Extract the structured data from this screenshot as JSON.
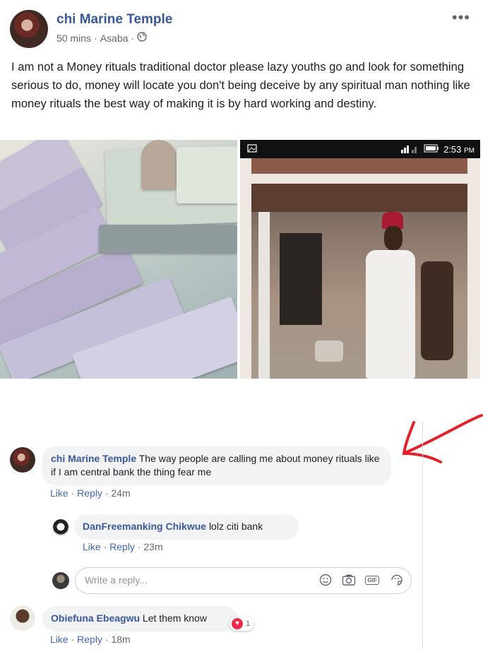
{
  "post": {
    "page_name": "chi Marine Temple",
    "time": "50 mins",
    "location": "Asaba",
    "separator": "·",
    "privacy_icon": "globe-icon",
    "more_icon": "more-dots-icon",
    "more_glyph": "•••",
    "text": "I am not a Money rituals traditional doctor please lazy youths go and look for something serious to do, money will locate you don't being deceive by any spiritual man nothing like money rituals the best way of making it is by hard working and destiny."
  },
  "phone_screenshot": {
    "time": "2:53",
    "ampm": "PM"
  },
  "annotation": {
    "color": "#e3212a"
  },
  "comments": [
    {
      "author": "chi Marine Temple",
      "text": "The way people are calling me about money rituals like if I am central bank the thing fear me",
      "like": "Like",
      "reply": "Reply",
      "age": "24m",
      "replies": [
        {
          "author": "DanFreemanking Chikwue",
          "text": "lolz citi bank",
          "like": "Like",
          "reply": "Reply",
          "age": "23m"
        }
      ]
    },
    {
      "author": "Obiefuna Ebeagwu",
      "text": "Let them know",
      "like": "Like",
      "reply": "Reply",
      "age": "18m",
      "reaction_count": "1",
      "reaction_icon": "heart-reaction-icon"
    }
  ],
  "reply_box": {
    "placeholder": "Write a reply...",
    "icons": [
      "emoji-icon",
      "camera-icon",
      "gif-icon",
      "sticker-icon"
    ],
    "gif_label": "GIF"
  },
  "colors": {
    "link": "#385898",
    "action": "#4267b2",
    "muted": "#606770",
    "bubble": "#f2f3f5"
  }
}
